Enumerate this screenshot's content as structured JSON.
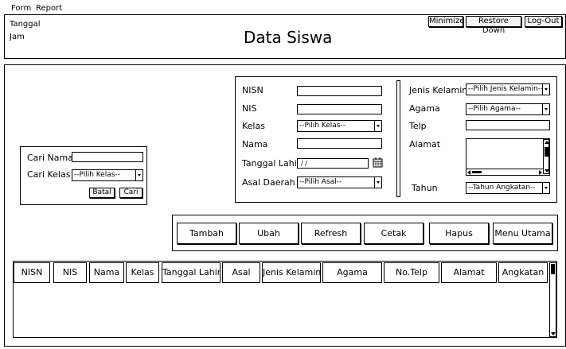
{
  "menubar": {
    "items": [
      "Form",
      "Report"
    ]
  },
  "header": {
    "date_label": "Tanggal",
    "time_label": "Jam",
    "title": "Data Siswa",
    "buttons": [
      "Minimize",
      "Restore Down",
      "Log-Out"
    ]
  },
  "search": {
    "name_label": "Cari Nama",
    "class_label": "Cari Kelas",
    "class_select": "--Pilih Kelas--",
    "cancel_label": "Batal",
    "search_label": "Cari"
  },
  "form_left": {
    "nisn_label": "NISN",
    "nis_label": "NIS",
    "kelas_label": "Kelas",
    "kelas_select": "--Pilih Kelas--",
    "nama_label": "Nama",
    "tgl_label": "Tanggal Lahir",
    "tgl_value": "/ /",
    "asal_label": "Asal Daerah",
    "asal_select": "--Pilih Asal--"
  },
  "form_right": {
    "jk_label": "Jenis Kelamin",
    "jk_select": "--Pilih Jenis Kelamin--",
    "agama_label": "Agama",
    "agama_select": "--Pilih Agama--",
    "telp_label": "Telp",
    "alamat_label": "Alamat",
    "tahun_label": "Tahun",
    "tahun_select": "--Tahun Angkatan--"
  },
  "actions": [
    "Tambah",
    "Ubah",
    "Refresh",
    "Cetak",
    "Hapus",
    "Menu Utama"
  ],
  "table": {
    "columns": [
      "NISN",
      "NIS",
      "Nama",
      "Kelas",
      "Tanggal Lahir",
      "Asal",
      "Jenis Kelamin",
      "Agama",
      "No.Telp",
      "Alamat",
      "Angkatan"
    ]
  }
}
